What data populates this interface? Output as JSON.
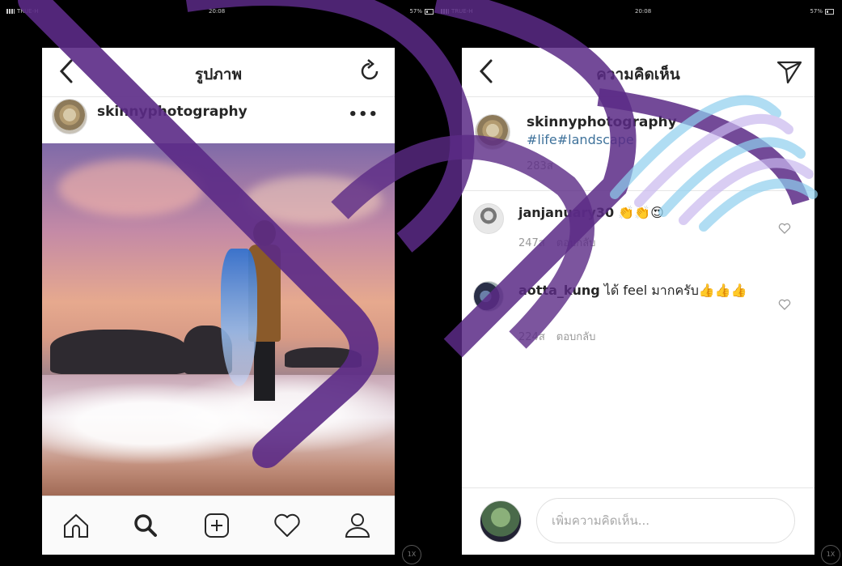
{
  "left_status": {
    "carrier": "TRUE-H",
    "time": "20:08",
    "battery": "57%"
  },
  "right_status": {
    "carrier": "TRUE-H",
    "time": "20:08",
    "battery": "57%"
  },
  "photo_screen": {
    "title": "รูปภาพ",
    "username": "skinnyphotography",
    "more_label": "•••",
    "tabs": [
      "home-icon",
      "search-icon",
      "add-post-icon",
      "heart-icon",
      "profile-icon"
    ]
  },
  "comments_screen": {
    "title": "ความคิดเห็น",
    "caption": {
      "username": "skinnyphotography",
      "text": "#life#landscape",
      "time": "283ส"
    },
    "comments": [
      {
        "username": "janjanuary30",
        "text": "👏👏😍",
        "time": "247ส",
        "reply_label": "ตอบกลับ"
      },
      {
        "username": "aotta_kung",
        "text": "ได้ feel มากครับ👍👍👍",
        "time": "224ส",
        "reply_label": "ตอบกลับ"
      }
    ],
    "input_placeholder": "เพิ่มความคิดเห็น..."
  },
  "zoom_badge": "1X",
  "colors": {
    "hashtag": "#3f729b",
    "text": "#262626",
    "meta": "#999999",
    "watermark_purple": "#5b2a86",
    "watermark_blue": "#8fd0ef"
  }
}
